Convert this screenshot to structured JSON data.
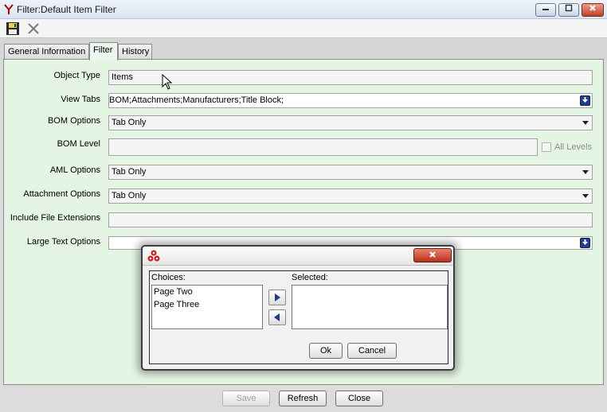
{
  "window": {
    "title": "Filter:Default Item Filter",
    "logo_icon": "innovator-logo-icon",
    "minimize_icon": "minimize-icon",
    "maximize_icon": "maximize-icon",
    "close_icon": "close-icon"
  },
  "toolbar": {
    "save_icon": "floppy-save-icon",
    "delete_icon": "x-delete-icon"
  },
  "tabs": [
    {
      "label": "General Information"
    },
    {
      "label": "Filter"
    },
    {
      "label": "History"
    }
  ],
  "form": {
    "object_type": {
      "label": "Object Type",
      "value": "Items"
    },
    "view_tabs": {
      "label": "View Tabs",
      "value": "BOM;Attachments;Manufacturers;Title Block;"
    },
    "bom_options": {
      "label": "BOM Options",
      "value": "Tab Only"
    },
    "bom_level": {
      "label": "BOM Level",
      "value": "",
      "checkbox_label": "All Levels",
      "checked": false
    },
    "aml_options": {
      "label": "AML Options",
      "value": "Tab Only"
    },
    "attachment_options": {
      "label": "Attachment Options",
      "value": "Tab Only"
    },
    "include_file_extensions": {
      "label": "Include File Extensions",
      "value": ""
    },
    "large_text_options": {
      "label": "Large Text Options",
      "value": ""
    }
  },
  "dialog": {
    "icon": "innovator-dialog-icon",
    "close_icon": "close-icon",
    "choices_label": "Choices:",
    "selected_label": "Selected:",
    "choices": [
      "Page Two",
      "Page Three"
    ],
    "selected": [],
    "ok_label": "Ok",
    "cancel_label": "Cancel"
  },
  "bottom": {
    "save_label": "Save",
    "refresh_label": "Refresh",
    "close_label": "Close"
  },
  "colors": {
    "panel_bg": "#e4f5e4",
    "accent_blue": "#1f3f8f",
    "close_red": "#c0402a"
  }
}
